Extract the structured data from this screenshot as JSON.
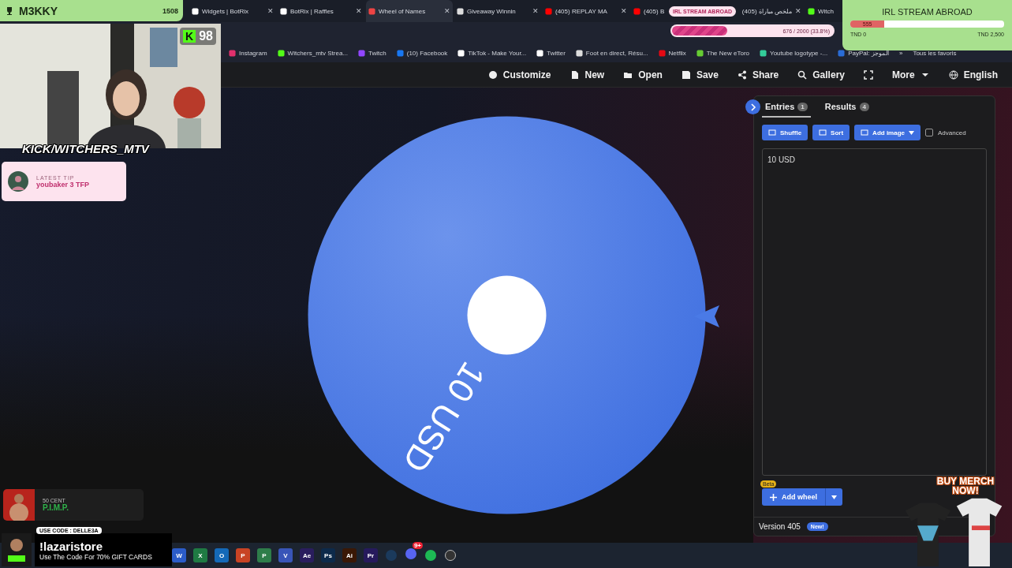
{
  "browser": {
    "tabs": [
      {
        "title": "Widgets | BotRix",
        "selected": false,
        "close": "✕"
      },
      {
        "title": "BotRix | Raffles",
        "selected": false,
        "close": "✕"
      },
      {
        "title": "Wheel of Names",
        "selected": true,
        "close": "✕"
      },
      {
        "title": "Giveaway Winnin",
        "selected": false,
        "close": "✕"
      },
      {
        "title": "(405) REPLAY MA",
        "selected": false,
        "close": "✕"
      },
      {
        "title": "(405) B",
        "selected": false
      },
      {
        "title": "ملخص مباراة (405)",
        "selected": false,
        "close": "✕"
      },
      {
        "title": "Witch",
        "selected": false
      }
    ],
    "bookmarks": [
      "Instagram",
      "Witchers_mtv Strea...",
      "Twitch",
      "(10) Facebook",
      "TikTok - Make Your...",
      "Twitter",
      "Foot en direct, Résu...",
      "Netflix",
      "The New eToro",
      "Youtube logotype -...",
      "PayPal: الموجز"
    ],
    "bookmarks_more": "»",
    "all_bookmarks": "Tous les favoris"
  },
  "toolbar": [
    "Customize",
    "New",
    "Open",
    "Save",
    "Share",
    "Gallery",
    "More",
    "English"
  ],
  "wheel": {
    "segments": [
      {
        "label": "10 USD",
        "color": "#3f6fe0"
      }
    ]
  },
  "panel": {
    "tabs": [
      {
        "label": "Entries",
        "count": "1",
        "selected": true
      },
      {
        "label": "Results",
        "count": "4",
        "selected": false
      }
    ],
    "buttons": [
      "Shuffle",
      "Sort",
      "Add image"
    ],
    "advanced": {
      "label": "Advanced",
      "checked": false
    },
    "entries": "10 USD",
    "beta": "Beta",
    "add_wheel": "Add wheel",
    "version": "Version 405",
    "new_badge": "New!"
  },
  "overlays": {
    "leader": {
      "name": "M3KKY",
      "score": "1508"
    },
    "viewers": {
      "letter": "K",
      "count": "98"
    },
    "channel": "KICK/WITCHERS_MTV",
    "tip": {
      "heading": "LATEST TIP",
      "text": "youbaker 3 TFP"
    },
    "stream_goal": {
      "label": "IRL STREAM ABROAD",
      "reading": "676 / 2000 (33.8%)",
      "level": 0.338
    },
    "donation_goal": {
      "title": "IRL STREAM ABROAD",
      "bar_text": "555",
      "level": 0.222,
      "min": "TND 0",
      "max": "TND 2,500"
    },
    "song": {
      "artist": "50 CENT",
      "title": "P.I.M.P."
    },
    "promo": {
      "code": "USE CODE : DELLE3A",
      "name": "!lazaristore",
      "text": "Use The Code For 70% GIFT CARDS"
    },
    "merch": "BUY MERCH NOW!"
  },
  "taskbar": {
    "apps": [
      {
        "label": "W",
        "color": "#2b5cc9"
      },
      {
        "label": "X",
        "color": "#1f7a43"
      },
      {
        "label": "O",
        "color": "#1469b8"
      },
      {
        "label": "P",
        "color": "#c84324"
      },
      {
        "label": "P",
        "color": "#2e7d4a"
      },
      {
        "label": "V",
        "color": "#3955b8"
      },
      {
        "label": "Ae",
        "color": "#2a1d5e"
      },
      {
        "label": "Ps",
        "color": "#0d2a4a"
      },
      {
        "label": "Ai",
        "color": "#3a1806"
      },
      {
        "label": "Pr",
        "color": "#261a5c"
      }
    ],
    "discord_badge": "9+"
  }
}
